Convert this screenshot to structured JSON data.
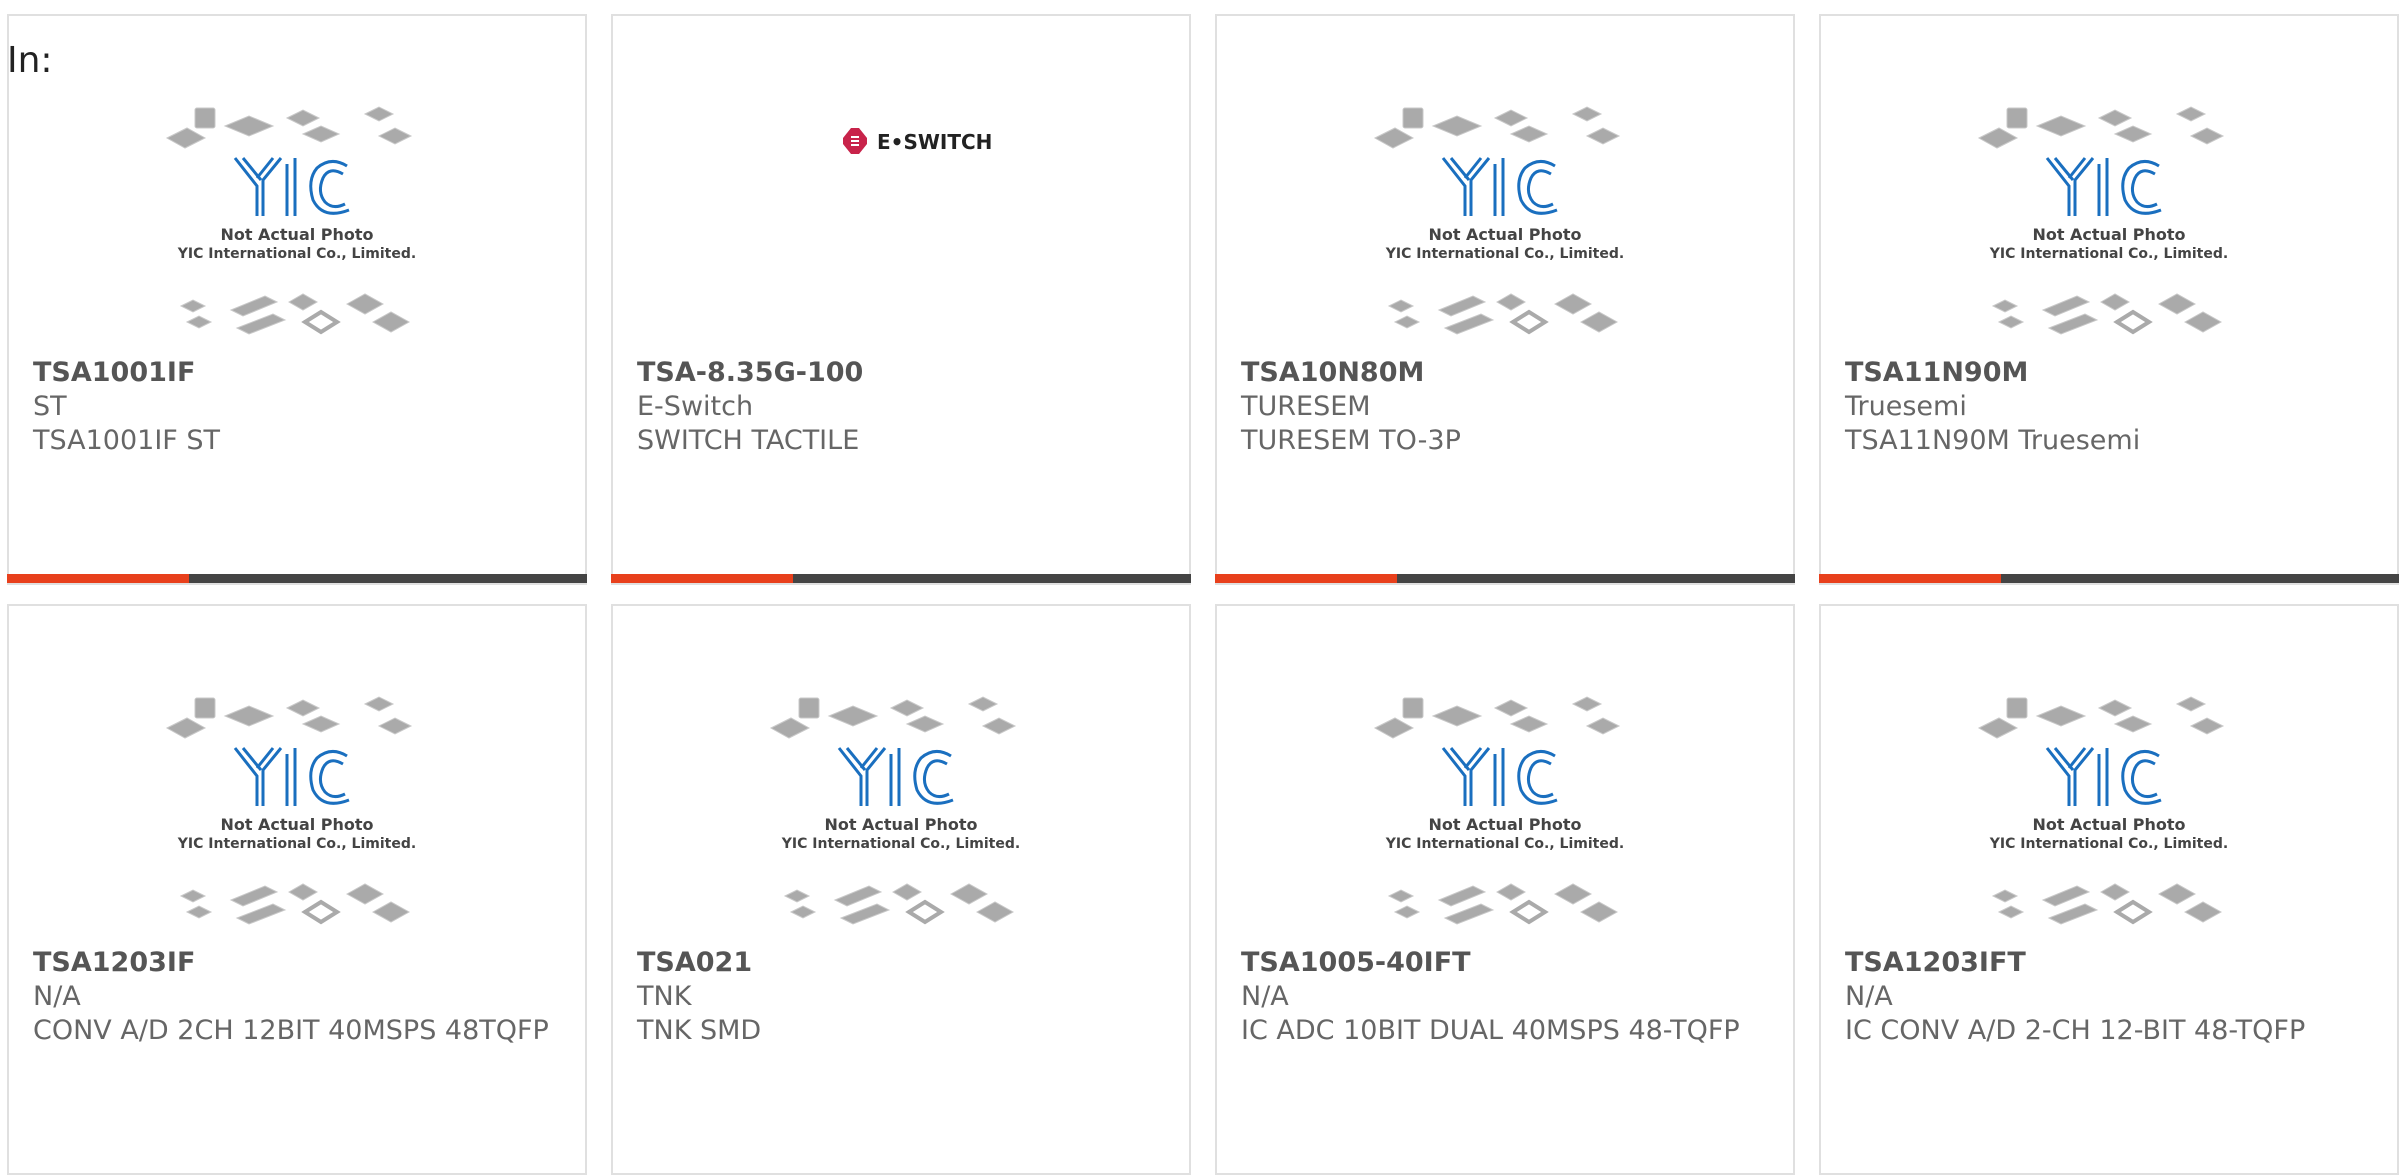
{
  "filter_label": "In:",
  "accent_color": "#e8401c",
  "bar_color": "#444444",
  "placeholder": {
    "caption_line1": "Not Actual Photo",
    "caption_line2": "YIC International Co., Limited.",
    "logo_text": "YIC"
  },
  "eswitch_logo_text": "E•SWITCH",
  "products": [
    {
      "part": "TSA1001IF",
      "manufacturer": "ST",
      "description": "TSA1001IF ST",
      "image": "yic-placeholder"
    },
    {
      "part": "TSA-8.35G-100",
      "manufacturer": "E-Switch",
      "description": "SWITCH TACTILE",
      "image": "eswitch-logo"
    },
    {
      "part": "TSA10N80M",
      "manufacturer": "TURESEM",
      "description": "TURESEM TO-3P",
      "image": "yic-placeholder"
    },
    {
      "part": "TSA11N90M",
      "manufacturer": "Truesemi",
      "description": "TSA11N90M Truesemi",
      "image": "yic-placeholder"
    },
    {
      "part": "TSA1203IF",
      "manufacturer": "N/A",
      "description": "CONV A/D 2CH 12BIT 40MSPS 48TQFP",
      "image": "yic-placeholder"
    },
    {
      "part": "TSA021",
      "manufacturer": "TNK",
      "description": "TNK SMD",
      "image": "yic-placeholder"
    },
    {
      "part": "TSA1005-40IFT",
      "manufacturer": "N/A",
      "description": "IC ADC 10BIT DUAL 40MSPS 48-TQFP",
      "image": "yic-placeholder"
    },
    {
      "part": "TSA1203IFT",
      "manufacturer": "N/A",
      "description": "IC CONV A/D 2-CH 12-BIT 48-TQFP",
      "image": "yic-placeholder"
    }
  ]
}
